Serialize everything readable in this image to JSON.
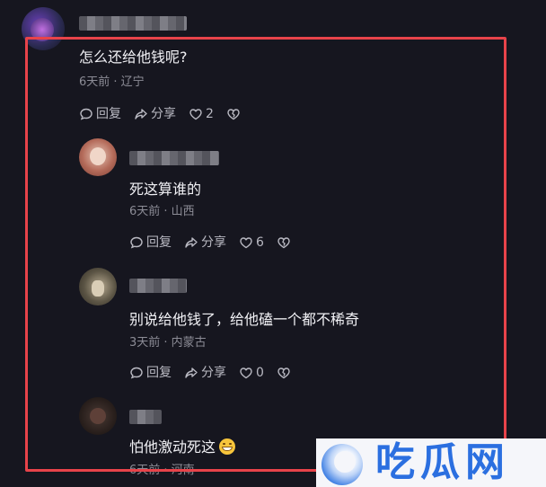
{
  "comments": [
    {
      "text": "怎么还给他钱呢?",
      "meta": "6天前 · 辽宁",
      "reply": "回复",
      "share": "分享",
      "likes": "2"
    },
    {
      "text": "死这算谁的",
      "meta": "6天前 · 山西",
      "reply": "回复",
      "share": "分享",
      "likes": "6"
    },
    {
      "text": "别说给他钱了，给他磕一个都不稀奇",
      "meta": "3天前 · 内蒙古",
      "reply": "回复",
      "share": "分享",
      "likes": "0"
    },
    {
      "text": "怕他激动死这",
      "meta": "6天前 · 河南"
    }
  ],
  "watermark": {
    "text": "吃瓜网"
  },
  "colors": {
    "highlight": "#e8434a",
    "background": "#16161f",
    "watermark_text": "#2b6fe0"
  }
}
